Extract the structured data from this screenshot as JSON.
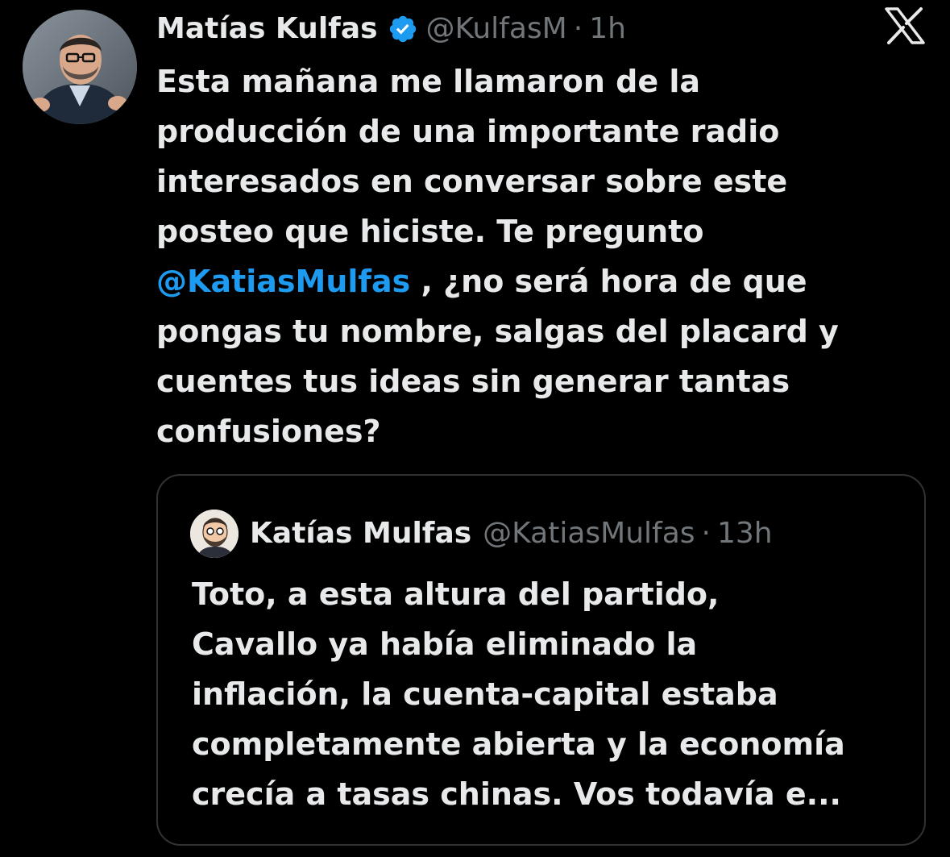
{
  "tweet": {
    "author": {
      "display_name": "Matías Kulfas",
      "handle": "@KulfasM",
      "verified": true,
      "avatar_icon": "profile-photo"
    },
    "separator": "·",
    "time": "1h",
    "text_lines": [
      "Esta mañana me llamaron de la",
      "producción de una importante radio",
      "interesados en conversar sobre este",
      "posteo que hiciste. Te pregunto"
    ],
    "mention": "@KatiasMulfas",
    "text_after_mention": " , ¿no será hora de que",
    "text_lines_end": [
      "pongas tu nombre, salgas del placard y",
      "cuentes tus ideas sin generar tantas",
      "confusiones?"
    ]
  },
  "quoted_tweet": {
    "author": {
      "display_name": "Katías Mulfas",
      "handle": "@KatiasMulfas",
      "avatar_icon": "caricature-avatar"
    },
    "separator": "·",
    "time": "13h",
    "text_lines": [
      "Toto, a esta altura del partido,",
      "Cavallo ya había eliminado la",
      "inflación, la cuenta-capital estaba",
      "completamente abierta y la economía",
      "crecía a tasas chinas. Vos todavía e..."
    ]
  },
  "brand": {
    "logo_icon": "x-logo"
  },
  "colors": {
    "background": "#000000",
    "text": "#e7e9ea",
    "secondary_text": "#71767b",
    "link": "#1d9bf0",
    "verified_badge": "#1d9bf0",
    "card_border": "#2f3336"
  }
}
